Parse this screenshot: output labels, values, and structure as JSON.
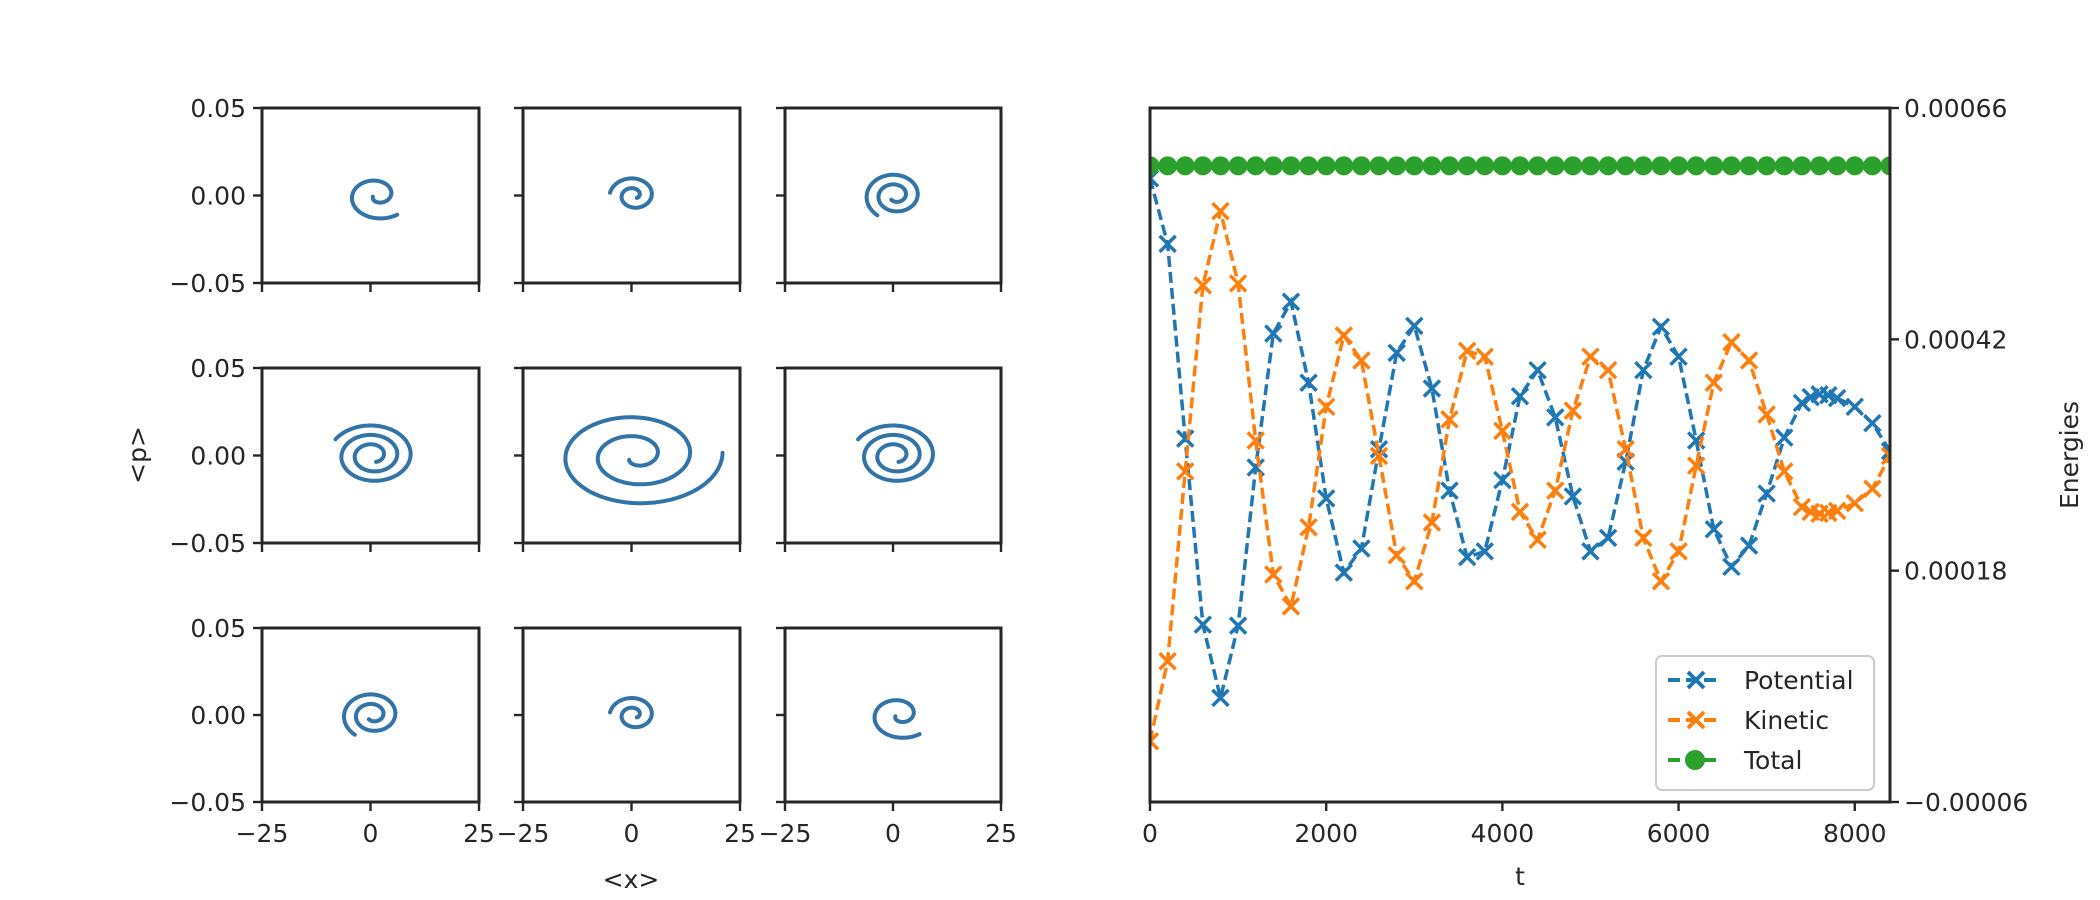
{
  "chart_data": [
    {
      "type": "line",
      "title": "",
      "kind": "phase-space grid",
      "xlabel": "<x>",
      "ylabel": "<p>",
      "xlim": [
        -25,
        25
      ],
      "ylim": [
        -0.05,
        0.05
      ],
      "xticks": [
        "−25",
        "0",
        "25"
      ],
      "yticks": [
        "0.05",
        "0.00",
        "−0.05"
      ],
      "xtick_values": [
        -25,
        0,
        25
      ],
      "ytick_values": [
        0.05,
        0.0,
        -0.05
      ],
      "color": "#3274a8",
      "grid": false,
      "rows": 3,
      "cols": 3,
      "panels": [
        {
          "row": 0,
          "col": 0,
          "r_start_x": 1.0,
          "r_end_x": 7.5,
          "r_start_p": 0.002,
          "r_end_p": 0.014,
          "turns": 1.3,
          "cx": 1.5,
          "cp": 0.0,
          "phase_end": -0.9
        },
        {
          "row": 0,
          "col": 1,
          "r_start_x": 1.0,
          "r_end_x": 5.5,
          "r_start_p": 0.002,
          "r_end_p": 0.011,
          "turns": 1.6,
          "cx": 0.5,
          "cp": 0.0,
          "phase_end": 3.0
        },
        {
          "row": 0,
          "col": 2,
          "r_start_x": 1.5,
          "r_end_x": 7.0,
          "r_start_p": 0.003,
          "r_end_p": 0.014,
          "turns": 2.0,
          "cx": 0.5,
          "cp": 0.0,
          "phase_end": -2.2
        },
        {
          "row": 1,
          "col": 0,
          "r_start_x": 2.0,
          "r_end_x": 10.0,
          "r_start_p": 0.004,
          "r_end_p": 0.018,
          "turns": 2.6,
          "cx": 0.5,
          "cp": 0.0,
          "phase_end": 2.6
        },
        {
          "row": 1,
          "col": 1,
          "r_start_x": 2.0,
          "r_end_x": 20.0,
          "r_start_p": 0.004,
          "r_end_p": 0.03,
          "turns": 2.4,
          "cx": 1.0,
          "cp": 0.0,
          "phase_end": 0.05
        },
        {
          "row": 1,
          "col": 2,
          "r_start_x": 2.0,
          "r_end_x": 10.0,
          "r_start_p": 0.004,
          "r_end_p": 0.018,
          "turns": 2.6,
          "cx": 0.5,
          "cp": 0.0,
          "phase_end": 2.6
        },
        {
          "row": 2,
          "col": 0,
          "r_start_x": 1.5,
          "r_end_x": 7.0,
          "r_start_p": 0.003,
          "r_end_p": 0.014,
          "turns": 2.0,
          "cx": 0.5,
          "cp": 0.0,
          "phase_end": -2.2
        },
        {
          "row": 2,
          "col": 1,
          "r_start_x": 1.0,
          "r_end_x": 5.5,
          "r_start_p": 0.002,
          "r_end_p": 0.011,
          "turns": 1.6,
          "cx": 0.5,
          "cp": 0.0,
          "phase_end": 3.0
        },
        {
          "row": 2,
          "col": 2,
          "r_start_x": 1.0,
          "r_end_x": 7.5,
          "r_start_p": 0.002,
          "r_end_p": 0.014,
          "turns": 1.3,
          "cx": 1.5,
          "cp": 0.0,
          "phase_end": -0.9
        }
      ]
    },
    {
      "type": "line",
      "title": "",
      "xlabel": "t",
      "ylabel": "Energies",
      "ylabel_side": "right",
      "xlim": [
        0,
        8400
      ],
      "ylim": [
        -6e-05,
        0.00066
      ],
      "xticks": [
        0,
        2000,
        4000,
        6000,
        8000
      ],
      "xtick_labels": [
        "0",
        "2000",
        "4000",
        "6000",
        "8000"
      ],
      "yticks": [
        0.00066,
        0.00042,
        0.00018,
        -6e-05
      ],
      "ytick_labels": [
        "0.00066",
        "0.00042",
        "0.00018",
        "−0.00006"
      ],
      "grid": false,
      "legend": "lower-right",
      "series": [
        {
          "name": "Potential",
          "color": "#1f77b4",
          "marker": "x",
          "linestyle": "dashed",
          "x": [
            0,
            200,
            400,
            600,
            800,
            1000,
            1200,
            1400,
            1600,
            1800,
            2000,
            2200,
            2400,
            2600,
            2800,
            3000,
            3200,
            3400,
            3600,
            3800,
            4000,
            4200,
            4400,
            4600,
            4800,
            5000,
            5200,
            5400,
            5600,
            5800,
            6000,
            6200,
            6400,
            6600,
            6800,
            7000,
            7200,
            7400,
            7500,
            7600,
            7700,
            7800,
            8000,
            8200,
            8400
          ],
          "values": [
            0.000587,
            0.000519,
            0.000317,
            0.000124,
            4.8e-05,
            0.000123,
            0.000287,
            0.000426,
            0.000459,
            0.000375,
            0.000255,
            0.000178,
            0.000203,
            0.000306,
            0.000406,
            0.000434,
            0.000369,
            0.000263,
            0.000194,
            0.0002,
            0.000274,
            0.000361,
            0.000388,
            0.000339,
            0.000257,
            0.0002,
            0.000214,
            0.000293,
            0.000388,
            0.000433,
            0.000402,
            0.000315,
            0.000223,
            0.000184,
            0.000206,
            0.00026,
            0.000318,
            0.000354,
            0.00036,
            0.000363,
            0.000362,
            0.000359,
            0.00035,
            0.000333,
            0.000304
          ]
        },
        {
          "name": "Kinetic",
          "color": "#ff7f0e",
          "marker": "x",
          "linestyle": "dashed",
          "x": [
            0,
            200,
            400,
            600,
            800,
            1000,
            1200,
            1400,
            1600,
            1800,
            2000,
            2200,
            2400,
            2600,
            2800,
            3000,
            3200,
            3400,
            3600,
            3800,
            4000,
            4200,
            4400,
            4600,
            4800,
            5000,
            5200,
            5400,
            5600,
            5800,
            6000,
            6200,
            6400,
            6600,
            6800,
            7000,
            7200,
            7400,
            7500,
            7600,
            7700,
            7800,
            8000,
            8200,
            8400
          ],
          "values": [
            3e-06,
            8.6e-05,
            0.000283,
            0.000476,
            0.000553,
            0.000478,
            0.000315,
            0.000176,
            0.000143,
            0.000225,
            0.00035,
            0.000424,
            0.000398,
            0.000299,
            0.000196,
            0.000169,
            0.00023,
            0.000337,
            0.000408,
            0.000402,
            0.000325,
            0.000241,
            0.000212,
            0.000263,
            0.000346,
            0.000402,
            0.000388,
            0.000306,
            0.000214,
            0.000169,
            0.0002,
            0.000289,
            0.000375,
            0.000417,
            0.000398,
            0.000342,
            0.000283,
            0.000246,
            0.000241,
            0.000239,
            0.00024,
            0.000242,
            0.00025,
            0.000265,
            0.000299
          ]
        },
        {
          "name": "Total",
          "color": "#2ca02c",
          "marker": "o",
          "linestyle": "dashed",
          "x_start": 0,
          "x_step": 200,
          "x_end": 8400,
          "value": 0.0006
        }
      ]
    }
  ]
}
